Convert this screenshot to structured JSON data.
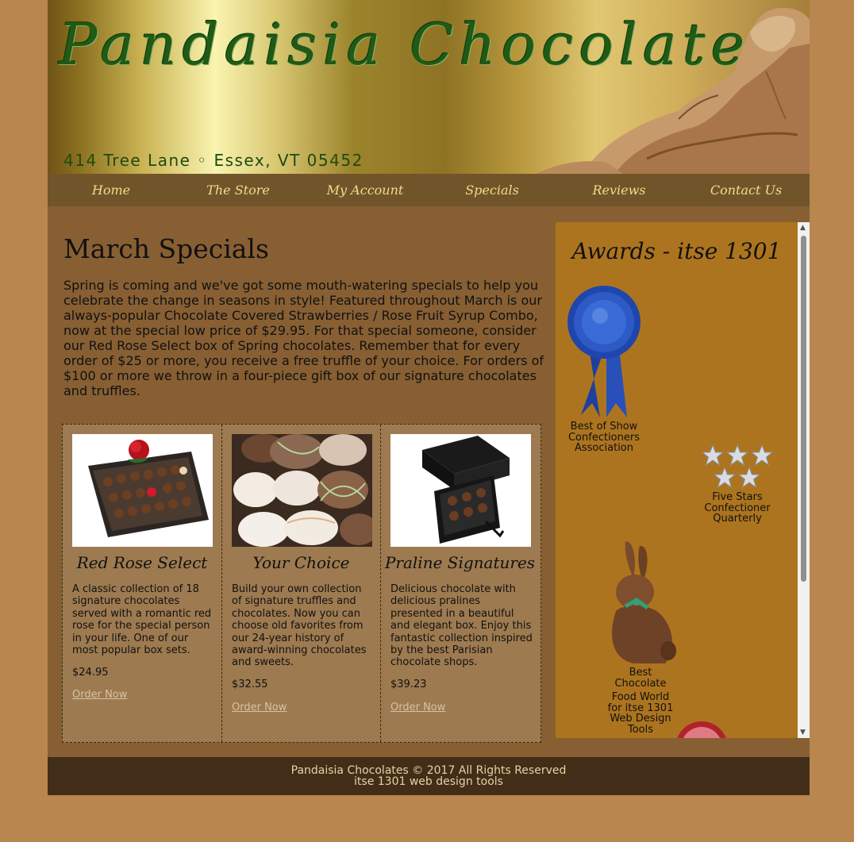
{
  "header": {
    "title": "Pandaisia Chocolates",
    "address": "414 Tree Lane ◦ Essex, VT 05452"
  },
  "nav": {
    "items": [
      {
        "label": "Home"
      },
      {
        "label": "The Store"
      },
      {
        "label": "My Account"
      },
      {
        "label": "Specials"
      },
      {
        "label": "Reviews"
      },
      {
        "label": "Contact Us"
      }
    ]
  },
  "main": {
    "title": "March Specials",
    "intro": "Spring is coming and we've got some mouth-watering specials to help you celebrate the change in seasons in style! Featured throughout March is our always-popular Chocolate Covered Strawberries / Rose Fruit Syrup Combo, now at the special low price of $29.95. For that special someone, consider our Red Rose Select box of Spring chocolates. Remember that for every order of $25 or more, you receive a free truffle of your choice. For orders of $100 or more we throw in a four-piece gift box of our signature chocolates and truffles.",
    "products": [
      {
        "name": "Red Rose Select",
        "description": "A classic collection of 18 signature chocolates served with a romantic red rose for the special person in your life. One of our most popular box sets.",
        "price": "$24.95",
        "link": "Order Now"
      },
      {
        "name": "Your Choice",
        "description": "Build your own collection of signature truffles and chocolates. Now you can choose old favorites from our 24-year history of award-winning chocolates and sweets.",
        "price": "$32.55",
        "link": "Order Now"
      },
      {
        "name": "Praline Signatures",
        "description": "Delicious chocolate with delicious pralines presented in a beautiful and elegant box. Enjoy this fantastic collection inspired by the best Parisian chocolate shops.",
        "price": "$39.23",
        "link": "Order Now"
      }
    ]
  },
  "sidebar": {
    "title": "Awards - itse 1301",
    "awards": [
      {
        "line1": "Best of Show",
        "line2": "Confectioners",
        "line3": "Association"
      },
      {
        "line1": "Five Stars",
        "line2": "Confectioner",
        "line3": "Quarterly"
      },
      {
        "line1": "Best",
        "line2": "Chocolate",
        "line3": "Food World",
        "line4": "for itse 1301",
        "line5": "Web Design",
        "line6": "Tools"
      }
    ]
  },
  "footer": {
    "line1": "Pandaisia Chocolates © 2017 All Rights Reserved",
    "line2": "itse 1301 web design tools"
  },
  "colors": {
    "page_bg": "#b9864f",
    "content_bg": "#875f33",
    "nav_bg": "#72542a",
    "nav_text": "#f3dc8a",
    "sidebar_bg": "#ad741f",
    "footer_bg": "#422d18",
    "title_green": "#1f5a16"
  }
}
